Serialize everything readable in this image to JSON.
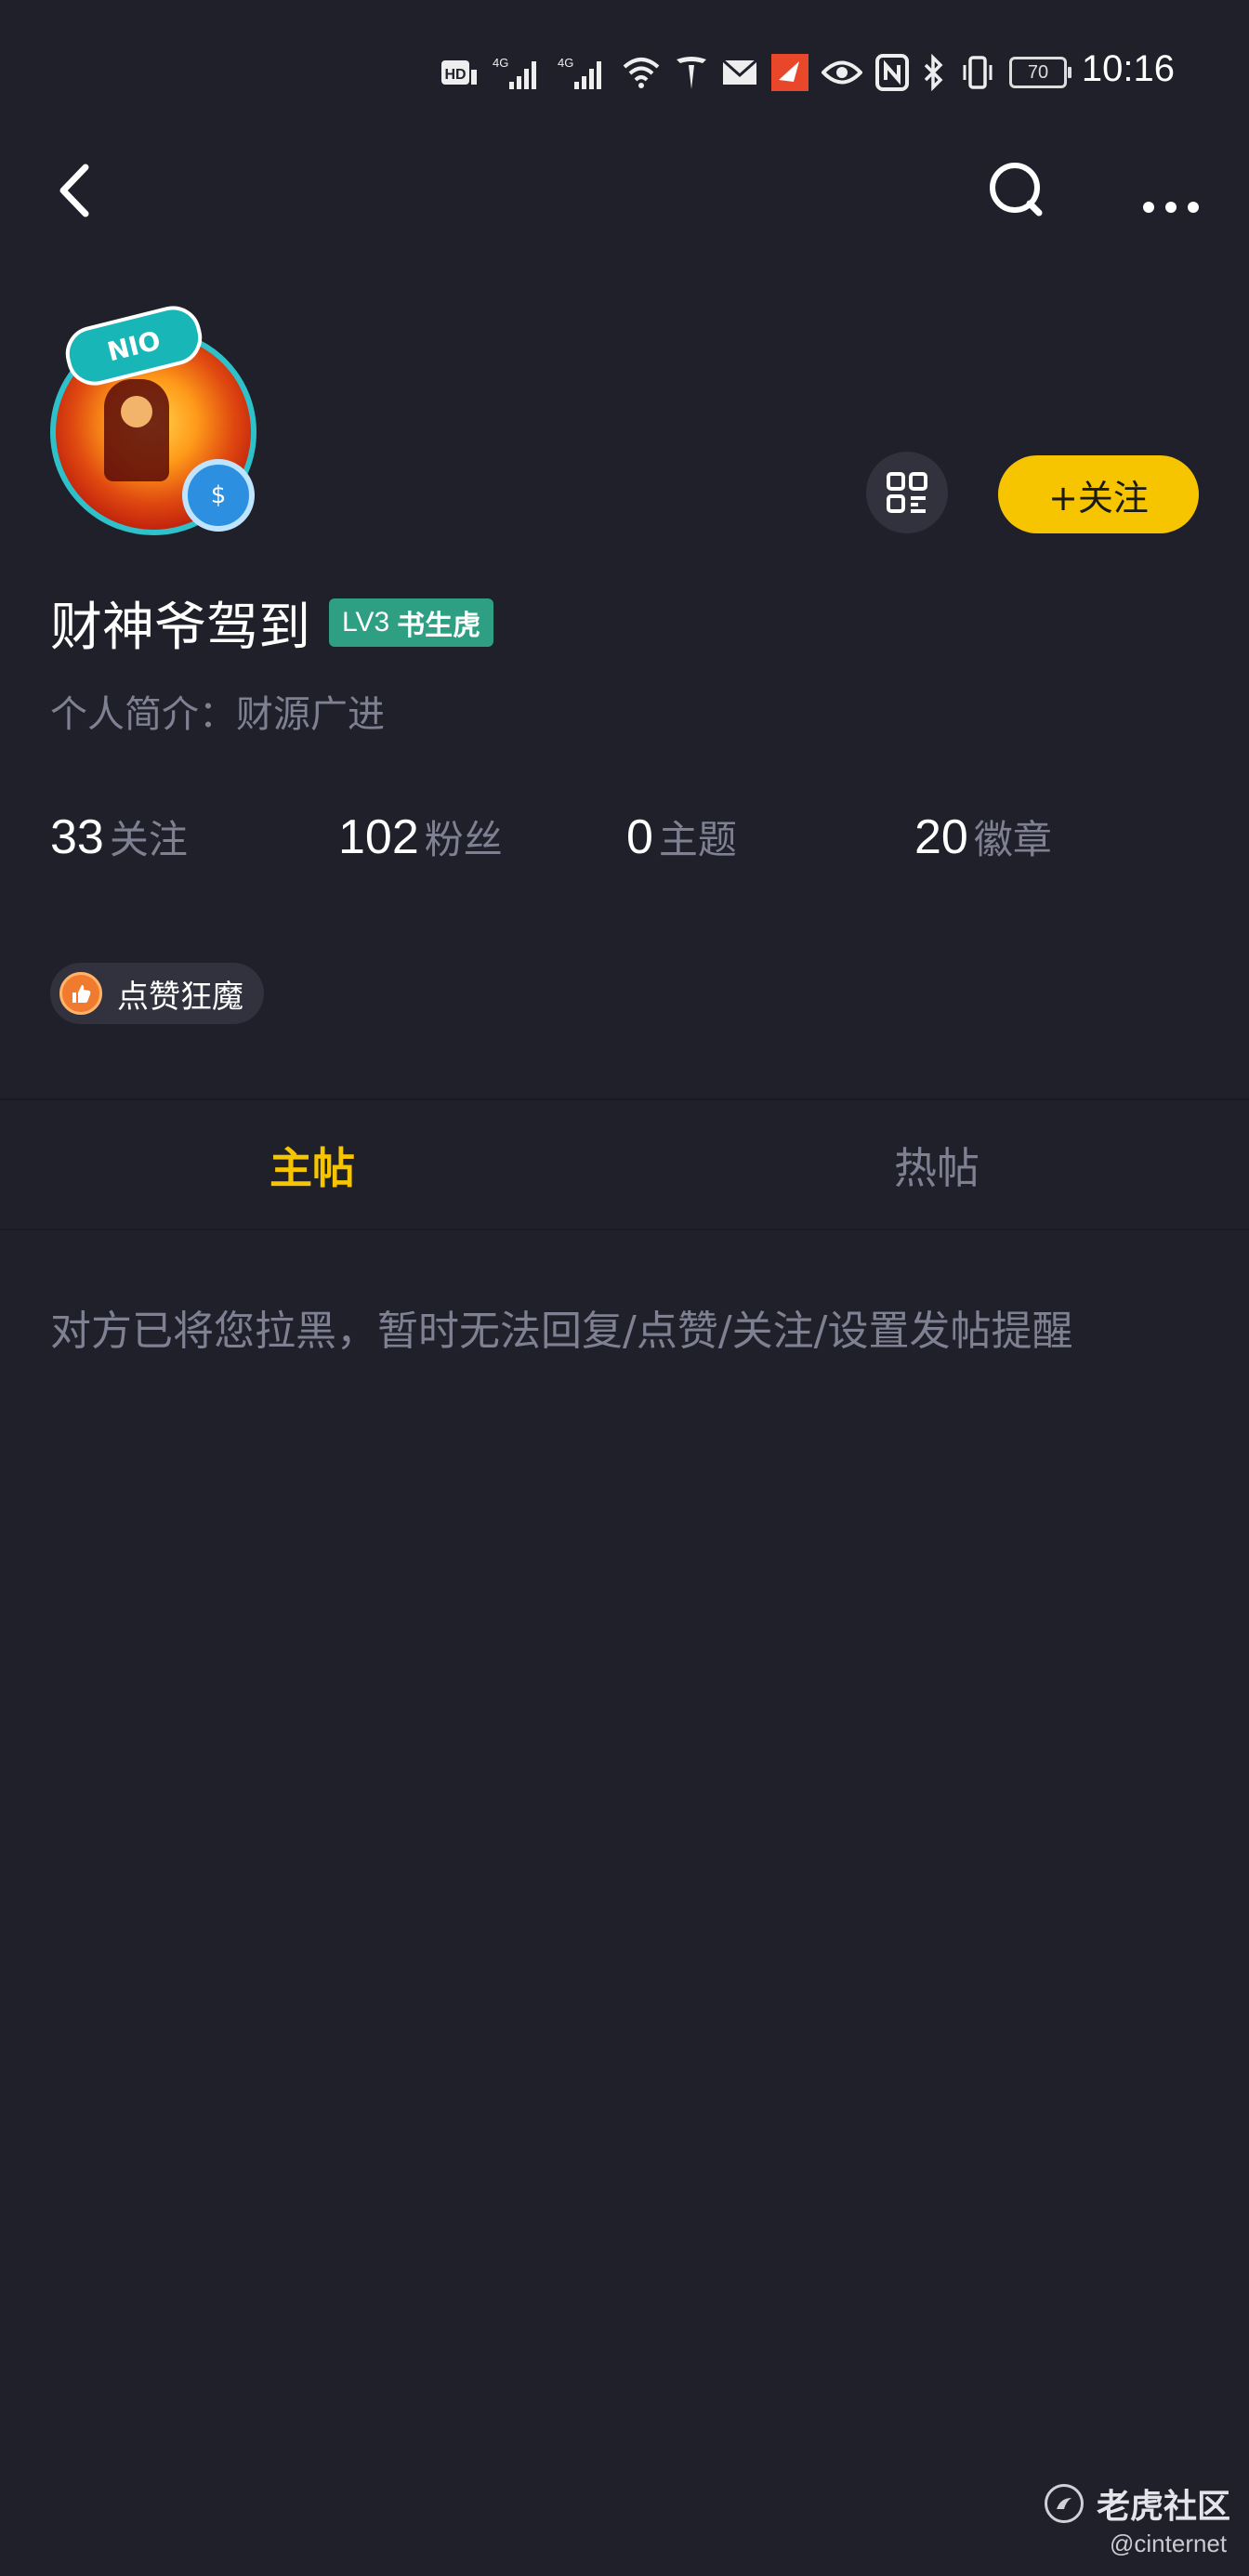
{
  "status_bar": {
    "time": "10:16",
    "battery": "70",
    "network_1": "4G",
    "network_2": "4G",
    "icons": [
      "hd-icon",
      "signal-icon",
      "signal-icon",
      "wifi-icon",
      "tesla-icon",
      "mail-icon",
      "app-icon",
      "eye-icon",
      "nfc-icon",
      "bluetooth-icon",
      "vibrate-icon",
      "battery-icon"
    ]
  },
  "nav": {
    "icons": [
      "back-arrow-icon",
      "search-icon",
      "more-icon"
    ]
  },
  "profile": {
    "avatar_badge": "NIO",
    "username": "财神爷驾到",
    "level": "LV3",
    "level_title": "书生虎",
    "bio": "个人简介：财源广进",
    "follow_button": "+关注",
    "stats": [
      {
        "value": "33",
        "label": "关注"
      },
      {
        "value": "102",
        "label": "粉丝"
      },
      {
        "value": "0",
        "label": "主题"
      },
      {
        "value": "20",
        "label": "徽章"
      }
    ],
    "medal": {
      "label": "点赞狂魔"
    }
  },
  "tabs": [
    {
      "label": "主帖",
      "active": true
    },
    {
      "label": "热帖",
      "active": false
    }
  ],
  "message": "对方已将您拉黑，暂时无法回复/点赞/关注/设置发帖提醒",
  "watermark": {
    "title": "老虎社区",
    "handle": "@cinternet"
  },
  "colors": {
    "background": "#20202b",
    "accent": "#f7c500",
    "level_badge": "#2e9f82",
    "muted_text": "#7f8193"
  }
}
